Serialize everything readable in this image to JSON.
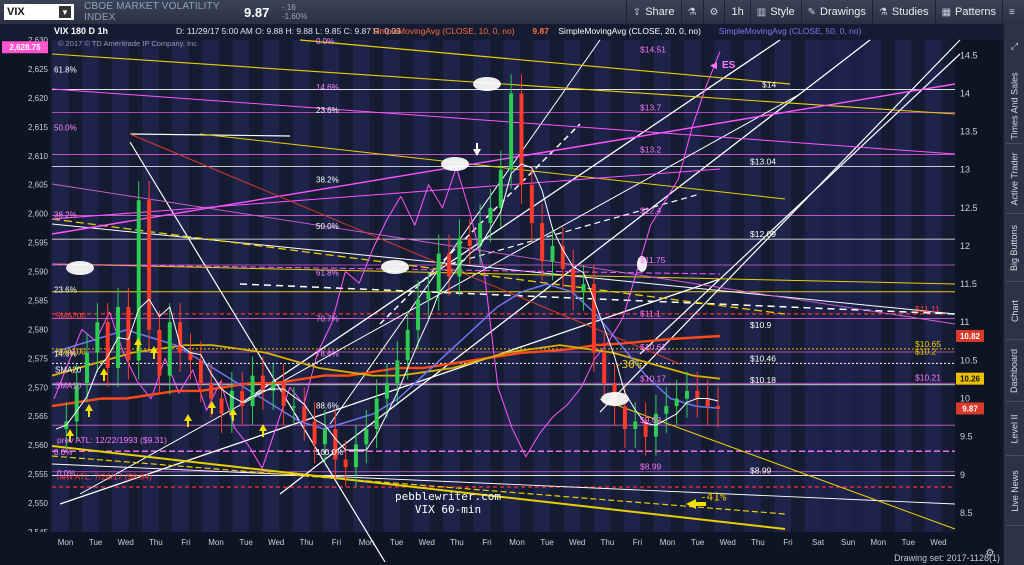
{
  "toolbar": {
    "symbol": "VIX",
    "symbol_name": "CBOE MARKET VOLATILITY INDEX",
    "last": "9.87",
    "net_change": "-.16",
    "pct_change": "-1.60%",
    "share_label": "Share",
    "timeframe_label": "1h",
    "style_label": "Style",
    "drawings_label": "Drawings",
    "studies_label": "Studies",
    "patterns_label": "Patterns"
  },
  "side_tabs": [
    "Times And Sales",
    "Active Trader",
    "Big Buttons",
    "Chart",
    "Dashboard",
    "Level II",
    "Live News"
  ],
  "footer": {
    "drawing_set": "Drawing set: 2017-1128(1)"
  },
  "chart_data": {
    "type": "line",
    "header": "VIX 180 D 1h",
    "ohlc_text": "D: 11/29/17 5:00 AM   O: 9.88   H: 9.88   L: 9.85   C: 9.87   R: 0.03",
    "sma_legend": [
      {
        "text": "SimpleMovingAvg (CLOSE, 10, 0, no)",
        "value": "9.87",
        "color": "#ff6b3a"
      },
      {
        "text": "SimpleMovingAvg (CLOSE, 20, 0, no)",
        "value": "",
        "color": "#ffffff"
      },
      {
        "text": "SimpleMovingAvg (CLOSE, 50, 0, no)",
        "value": "",
        "color": "#7a7af0"
      }
    ],
    "copyright": "© 2017 © TD Ameritrade IP Company, Inc.",
    "watermark": [
      "pebblewriter.com",
      "VIX 60-min"
    ],
    "left_axis": {
      "label": "left",
      "range": [
        2545,
        2630
      ],
      "ticks": [
        2630,
        2625,
        2620,
        2615,
        2610,
        2605,
        2600,
        2595,
        2590,
        2585,
        2580,
        2575,
        2570,
        2565,
        2560,
        2555,
        2550,
        2545
      ]
    },
    "left_axis_current": "2,628.75",
    "right_axis": {
      "range": [
        8.25,
        14.7
      ],
      "ticks": [
        "14.5",
        "14",
        "13.5",
        "13",
        "12.5",
        "12",
        "11.5",
        "11",
        "10.5",
        "10",
        "9.5",
        "9",
        "8.5"
      ]
    },
    "right_badges": [
      {
        "value": "10.82",
        "color": "#d93a2a"
      },
      {
        "value": "10.26",
        "color": "#e8c000"
      },
      {
        "value": "9.87",
        "color": "#d93a2a"
      }
    ],
    "x_labels": [
      "Mon",
      "Tue",
      "Wed",
      "Thu",
      "Fri",
      "Mon",
      "Tue",
      "Wed",
      "Thu",
      "Fri",
      "Mon",
      "Tue",
      "Wed",
      "Thu",
      "Fri",
      "Mon",
      "Tue",
      "Wed",
      "Thu",
      "Fri",
      "Mon",
      "Tue",
      "Wed",
      "Thu",
      "Fri",
      "Sat",
      "Sun",
      "Mon",
      "Tue",
      "Wed"
    ],
    "fib_left": [
      {
        "label": "0.0%",
        "level": 2629
      },
      {
        "label": "61.8%",
        "level": 2624
      },
      {
        "label": "14.6%",
        "level": 2621
      },
      {
        "label": "23.6%",
        "level": 2617
      },
      {
        "label": "50.0%",
        "level": 2614
      },
      {
        "label": "38.2%",
        "level": 2605
      },
      {
        "label": "38.2%",
        "level": 2599
      },
      {
        "label": "50.0%",
        "level": 2597
      },
      {
        "label": "61.8%",
        "level": 2589
      },
      {
        "label": "23.6%",
        "level": 2586
      },
      {
        "label": "70.7%",
        "level": 2581
      },
      {
        "label": "14.6%",
        "level": 2575
      },
      {
        "label": "78.6%",
        "level": 2575
      },
      {
        "label": "88.6%",
        "level": 2566
      },
      {
        "label": "0.0%",
        "level": 2558
      },
      {
        "label": "100.0%",
        "level": 2558
      }
    ],
    "price_labels": [
      {
        "text": "$14.51",
        "value": 14.51,
        "color": "#ff77ff"
      },
      {
        "text": "$13.7",
        "value": 13.75,
        "color": "#ff77ff"
      },
      {
        "text": "$13.2",
        "value": 13.2,
        "color": "#ff77ff"
      },
      {
        "text": "$12.4",
        "value": 12.4,
        "color": "#ff77ff"
      },
      {
        "text": "$11.75",
        "value": 11.75,
        "color": "#ff77ff"
      },
      {
        "text": "$11.1",
        "value": 11.05,
        "color": "#ff77ff"
      },
      {
        "text": "$10.61",
        "value": 10.61,
        "color": "#ff77ff"
      },
      {
        "text": "$10.17",
        "value": 10.2,
        "color": "#ff77ff"
      },
      {
        "text": "$9.62",
        "value": 9.65,
        "color": "#ff77ff"
      },
      {
        "text": "$8.99",
        "value": 9.04,
        "color": "#ff77ff"
      },
      {
        "text": "$14",
        "value": 14.05,
        "color": "#ffffff"
      },
      {
        "text": "$13.04",
        "value": 13.04,
        "color": "#ffffff"
      },
      {
        "text": "$12.09",
        "value": 12.09,
        "color": "#ffffff"
      },
      {
        "text": "$10.9",
        "value": 10.9,
        "color": "#ffffff"
      },
      {
        "text": "$10.46",
        "value": 10.46,
        "color": "#ffffff"
      },
      {
        "text": "$10.18",
        "value": 10.18,
        "color": "#ffffff"
      },
      {
        "text": "$8.99",
        "value": 8.99,
        "color": "#ffffff"
      },
      {
        "text": "$11.11",
        "value": 11.11,
        "color": "#ff4040"
      },
      {
        "text": "$10.65",
        "value": 10.65,
        "color": "#e8d000"
      },
      {
        "text": "$10.2",
        "value": 10.55,
        "color": "#e8d000"
      },
      {
        "text": "$10.21",
        "value": 10.21,
        "color": "#ff77ff"
      }
    ],
    "annotations": [
      {
        "text": "-30%",
        "color": "#e8d000"
      },
      {
        "text": "-41%",
        "color": "#e8d000"
      },
      {
        "text": "prev ATL: 12/22/1993 ($9.31)",
        "color": "#ff77ff"
      },
      {
        "text": "new ATL: 7/26/17 ($8.84)",
        "color": "#ff4040"
      },
      {
        "text": "SMA200",
        "color": "#ff4040"
      },
      {
        "text": "SMA100",
        "color": "#e8d000"
      },
      {
        "text": "SMA20",
        "color": "#ffffff"
      },
      {
        "text": "SMA10",
        "color": "#ff77ff"
      },
      {
        "text": "ES",
        "color": "#ff77ff"
      }
    ],
    "vix_close_series": [
      9.6,
      9.7,
      10.2,
      10.6,
      11.0,
      10.4,
      11.2,
      10.5,
      12.6,
      10.9,
      10.3,
      11.0,
      10.6,
      10.5,
      10.2,
      10.0,
      9.8,
      10.1,
      9.9,
      10.3,
      10.1,
      10.2,
      9.9,
      9.9,
      9.7,
      9.4,
      9.6,
      9.2,
      9.1,
      9.4,
      9.6,
      10.0,
      10.2,
      10.5,
      10.9,
      11.3,
      11.4,
      11.9,
      11.6,
      12.1,
      12.0,
      12.3,
      12.5,
      13.0,
      14.0,
      12.8,
      12.3,
      11.8,
      12.0,
      11.7,
      11.4,
      11.5,
      10.6,
      10.2,
      9.9,
      9.6,
      9.7,
      9.5,
      9.8,
      9.9,
      10.0,
      10.1,
      10.0,
      9.9,
      9.87
    ],
    "sma200_series": [
      9.9,
      9.95,
      10.0,
      10.0,
      10.05,
      10.1,
      10.1,
      10.15,
      10.2,
      10.2,
      10.25,
      10.3,
      10.3,
      10.35,
      10.4,
      10.4,
      10.45,
      10.5,
      10.55,
      10.6,
      10.62,
      10.65,
      10.7,
      10.72,
      10.75,
      10.78,
      10.8,
      10.82
    ],
    "sma100_series": [
      10.3,
      10.4,
      10.5,
      10.6,
      10.65,
      10.7,
      10.7,
      10.65,
      10.6,
      10.5,
      10.4,
      10.35,
      10.3,
      10.3,
      10.35,
      10.4,
      10.5,
      10.6,
      10.65,
      10.7,
      10.65,
      10.6,
      10.5,
      10.4,
      10.3,
      10.26
    ],
    "sma50_series": [
      10.6,
      10.7,
      10.8,
      10.9,
      10.8,
      10.7,
      10.5,
      10.3,
      10.1,
      9.9,
      9.7,
      9.6,
      9.7,
      9.8,
      10.0,
      10.3,
      10.6,
      10.9,
      11.2,
      11.4,
      11.5,
      11.4,
      11.1,
      10.7,
      10.3,
      10.0,
      9.9,
      9.87
    ],
    "pink_spx_series": [
      2568,
      2574,
      2580,
      2578,
      2583,
      2576,
      2571,
      2568,
      2575,
      2569,
      2573,
      2566,
      2571,
      2563,
      2560,
      2556,
      2563,
      2570,
      2567,
      2576,
      2581,
      2590,
      2588,
      2594,
      2599,
      2603,
      2598,
      2605,
      2601,
      2608,
      2600,
      2590,
      2570,
      2563,
      2558,
      2562,
      2565,
      2567,
      2570,
      2575,
      2578,
      2582,
      2590,
      2598,
      2602,
      2606,
      2615,
      2622,
      2628
    ]
  }
}
